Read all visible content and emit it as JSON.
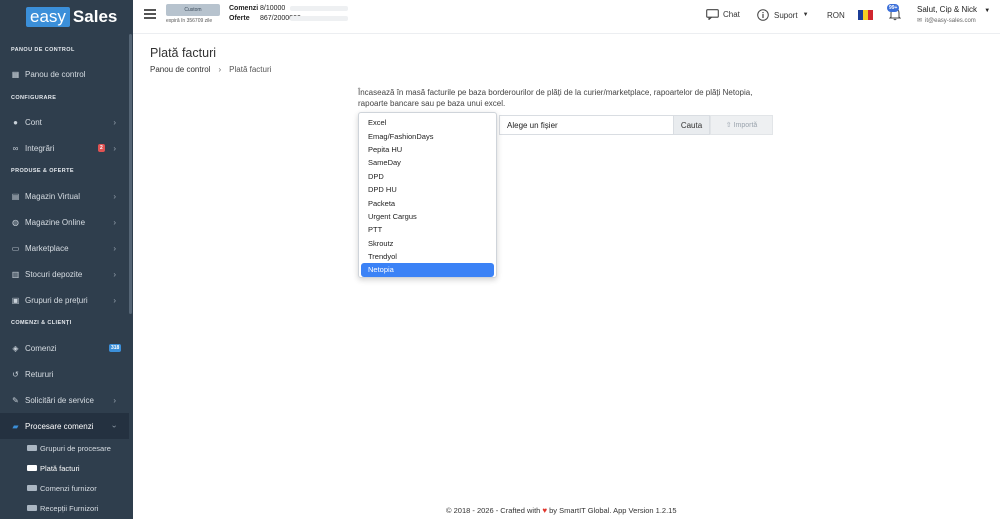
{
  "brand": {
    "logo_easy": "easy",
    "logo_sales": "Sales"
  },
  "topbar": {
    "plan_label": "Custom",
    "expiry": "expiră în 356709 zile",
    "orders_label": "Comenzi",
    "orders_value": "8/10000",
    "offers_label": "Oferte",
    "offers_value": "867/2000000",
    "chat": "Chat",
    "support": "Suport",
    "currency": "RON",
    "notif_badge": "99+",
    "user_greeting": "Salut, Cip & Nick",
    "user_email": "it@easy-sales.com"
  },
  "sidebar": {
    "sections": {
      "panel": "PANOU DE CONTROL",
      "config": "CONFIGURARE",
      "products": "PRODUSE & OFERTE",
      "orders": "COMENZI & CLIENȚI"
    },
    "items": {
      "panou": "Panou de control",
      "cont": "Cont",
      "integrari": "Integrări",
      "integrari_badge": "2",
      "magazin_virtual": "Magazin Virtual",
      "magazine_online": "Magazine Online",
      "marketplace": "Marketplace",
      "stocuri": "Stocuri depozite",
      "grupuri_preturi": "Grupuri de prețuri",
      "comenzi": "Comenzi",
      "comenzi_badge": "318",
      "retururi": "Retururi",
      "solicitari": "Solicitări de service",
      "procesare": "Procesare comenzi"
    },
    "subitems": {
      "grupuri_procesare": "Grupuri de procesare",
      "plata_facturi": "Plată facturi",
      "comenzi_furnizor": "Comenzi furnizor",
      "receptii": "Recepții Furnizori"
    }
  },
  "page": {
    "title": "Plată facturi",
    "breadcrumb_home": "Panou de control",
    "breadcrumb_current": "Plată facturi",
    "description": "Încasează în masă facturile pe baza borderourilor de plăți de la curier/marketplace, rapoartelor de plăți Netopia, rapoarte bancare sau pe baza unui excel.",
    "file_label": "Alege un fișier",
    "search_button": "Cauta",
    "import_button": "Importă",
    "select_options": [
      "Excel",
      "Emag/FashionDays",
      "Pepita HU",
      "SameDay",
      "DPD",
      "DPD HU",
      "Packeta",
      "Urgent Cargus",
      "PTT",
      "Skroutz",
      "Trendyol",
      "Netopia"
    ],
    "selected_option": "Netopia"
  },
  "footer": {
    "prefix": "© 2018 - 2026 - Crafted with",
    "suffix": "by SmartIT Global. App Version 1.2.15"
  },
  "colors": {
    "sidebar_bg": "#2f3e4d",
    "accent": "#3b82f6",
    "badge_red": "#e05252",
    "badge_blue": "#3b8fd9"
  }
}
